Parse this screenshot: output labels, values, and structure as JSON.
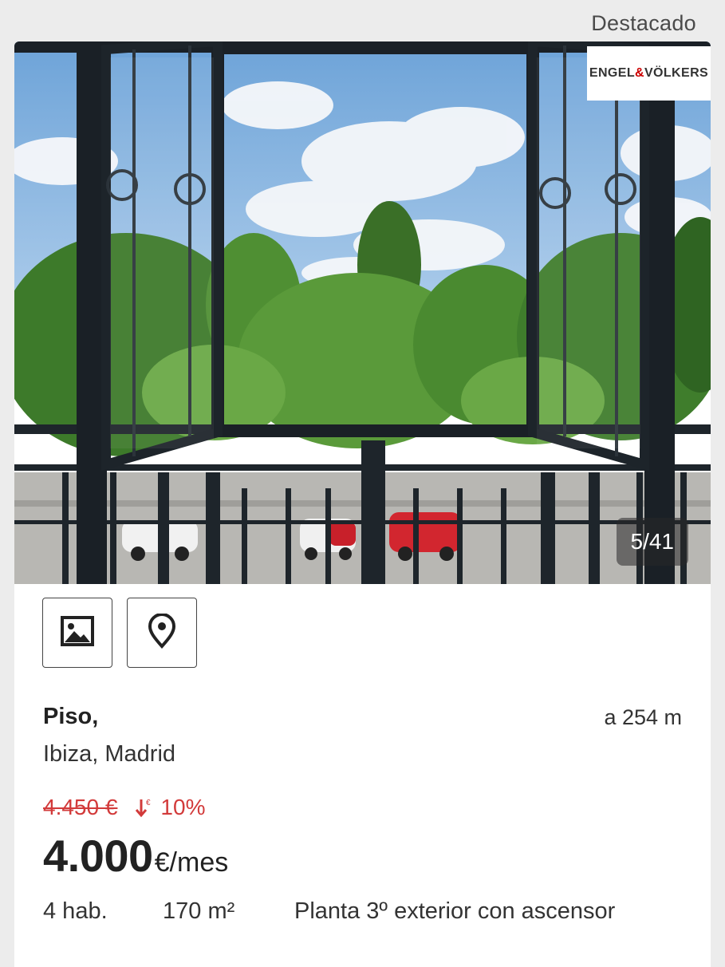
{
  "header": {
    "featured_label": "Destacado"
  },
  "listing": {
    "agency_logo_left": "ENGEL",
    "agency_logo_amp": "&",
    "agency_logo_right": "VÖLKERS",
    "photo_counter": "5/41",
    "actions": [
      {
        "name": "gallery",
        "icon": "image-icon"
      },
      {
        "name": "map",
        "icon": "map-pin-icon"
      }
    ],
    "title": "Piso,",
    "distance": "a 254 m",
    "location": "Ibiza, Madrid",
    "old_price": "4.450 €",
    "price_drop_pct": "10%",
    "price": "4.000",
    "price_unit": "€/mes",
    "features": {
      "rooms": "4 hab.",
      "size": "170 m²",
      "description": "Planta 3º exterior con ascensor"
    }
  },
  "colors": {
    "accent_red": "#d23a3a",
    "text_dark": "#222222",
    "background": "#ececec",
    "card": "#ffffff"
  }
}
